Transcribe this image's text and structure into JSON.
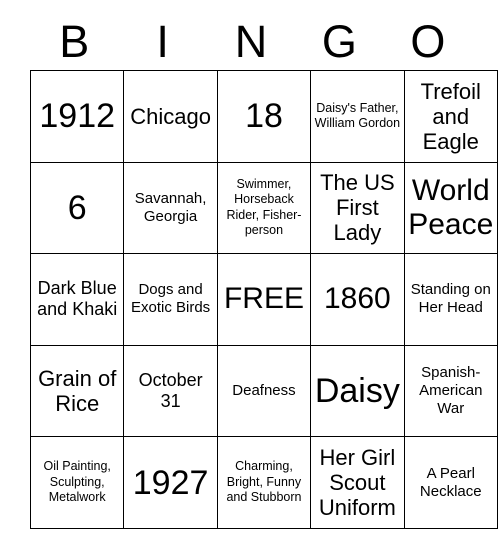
{
  "card": {
    "title": "BINGO Card",
    "header_letters": [
      "B",
      "I",
      "N",
      "G",
      "O"
    ],
    "rows": [
      [
        {
          "text": "1912",
          "size": "t-xl"
        },
        {
          "text": "Chicago",
          "size": "t-md"
        },
        {
          "text": "18",
          "size": "t-xl"
        },
        {
          "text": "Daisy's Father, William Gordon",
          "size": "t-xxs"
        },
        {
          "text": "Trefoil and Eagle",
          "size": "t-md"
        }
      ],
      [
        {
          "text": "6",
          "size": "t-xl"
        },
        {
          "text": "Savannah, Georgia",
          "size": "t-xs"
        },
        {
          "text": "Swimmer, Horseback Rider, Fisher-person",
          "size": "t-xxs"
        },
        {
          "text": "The US First Lady",
          "size": "t-md"
        },
        {
          "text": "World Peace",
          "size": "t-lg"
        }
      ],
      [
        {
          "text": "Dark Blue and Khaki",
          "size": "t-sm"
        },
        {
          "text": "Dogs and Exotic Birds",
          "size": "t-xs"
        },
        {
          "text": "FREE",
          "size": "t-lg"
        },
        {
          "text": "1860",
          "size": "t-lg"
        },
        {
          "text": "Standing on Her Head",
          "size": "t-xs"
        }
      ],
      [
        {
          "text": "Grain of Rice",
          "size": "t-md"
        },
        {
          "text": "October 31",
          "size": "t-sm"
        },
        {
          "text": "Deafness",
          "size": "t-xs"
        },
        {
          "text": "Daisy",
          "size": "t-xl"
        },
        {
          "text": "Spanish-American War",
          "size": "t-xs"
        }
      ],
      [
        {
          "text": "Oil Painting, Sculpting, Metalwork",
          "size": "t-xxs"
        },
        {
          "text": "1927",
          "size": "t-xl"
        },
        {
          "text": "Charming, Bright, Funny and Stubborn",
          "size": "t-xxs"
        },
        {
          "text": "Her Girl Scout Uniform",
          "size": "t-md"
        },
        {
          "text": "A Pearl Necklace",
          "size": "t-xs"
        }
      ]
    ]
  }
}
